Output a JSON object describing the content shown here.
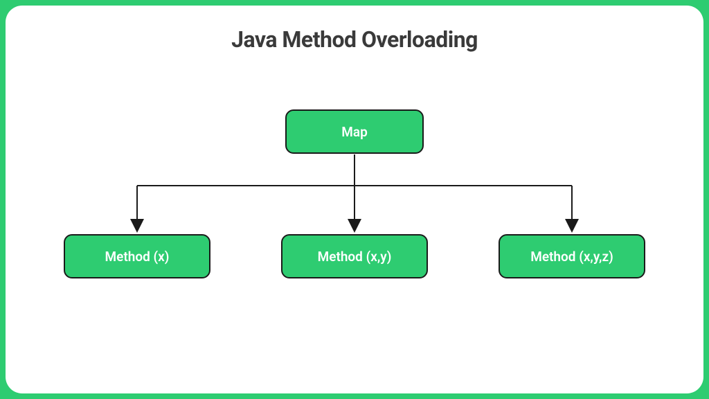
{
  "title": "Java Method Overloading",
  "diagram": {
    "parent": {
      "label": "Map"
    },
    "children": [
      {
        "label": "Method (x)"
      },
      {
        "label": "Method (x,y)"
      },
      {
        "label": "Method (x,y,z)"
      }
    ]
  },
  "colors": {
    "accent": "#2ecc71",
    "text_dark": "#3a3a3a",
    "border": "#1a1a1a"
  }
}
